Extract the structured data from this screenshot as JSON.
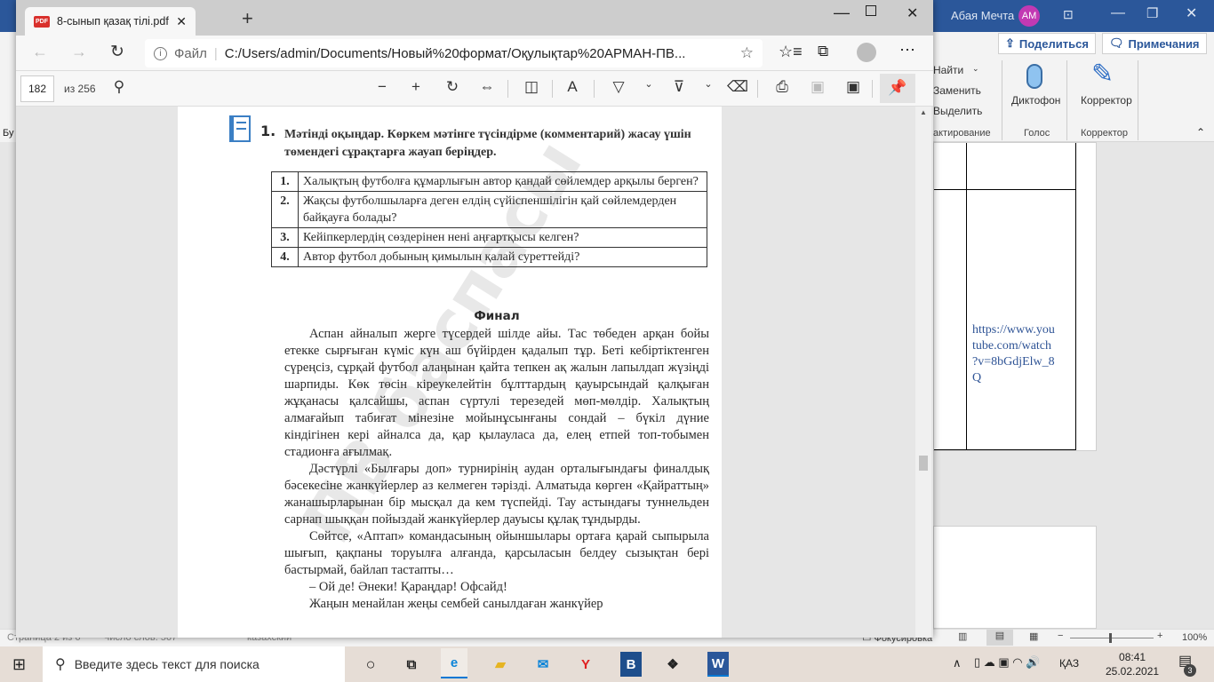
{
  "word": {
    "user_name": "Абая Мечта",
    "user_initials": "AM",
    "share_label": "Поделиться",
    "comments_label": "Примечания",
    "find_label": "Найти",
    "replace_label": "Заменить",
    "select_label": "Выделить",
    "editing_group": "актирование",
    "dictate_label": "Диктофон",
    "voice_group": "Голос",
    "editor_label": "Корректор",
    "editor_group": "Корректор",
    "left_cut_label": "Бу",
    "link_text": "https://www.youtube.com/watch?v=8bGdjElw_8Q",
    "link_lines": [
      "https://www.you",
      "tube.com/watch",
      "?v=8bGdjElw_8",
      "Q"
    ],
    "status": {
      "page": "Страница 2 из 6",
      "words": "Число слов: 567",
      "language": "казахский",
      "focus": "Фокусировка",
      "zoom": "100%"
    },
    "accent": "#2b579a"
  },
  "edge": {
    "tab_title": "8-сынып қазақ тілі.pdf",
    "url_prefix": "Файл",
    "url": "C:/Users/admin/Documents/Новый%20формат/Оқулықтар%20АРМАН-ПВ...",
    "pdf": {
      "page": "182",
      "of_pages": "из 256"
    }
  },
  "pdf_content": {
    "task_number": "1.",
    "task_text": "Мәтінді оқыңдар. Көркем мәтінге түсіндірме (комментарий) жасау үшін төмендегі сұрақтарға жауап беріңдер.",
    "questions": [
      {
        "n": "1.",
        "text": "Халықтың футболға құмарлығын автор қандай сөйлемдер арқылы берген?"
      },
      {
        "n": "2.",
        "text": "Жақсы футболшыларға деген елдің сүйіспеншілігін қай сөйлемдерден байқауға болады?"
      },
      {
        "n": "3.",
        "text": "Кейіпкерлердің сөздерінен нені аңғартқысы келген?"
      },
      {
        "n": "4.",
        "text": "Автор футбол добының қимылын қалай суреттейді?"
      }
    ],
    "story_title": "Финал",
    "paragraphs": [
      "Аспан айналып жерге түсердей шілде айы. Тас төбеден арқан бойы етекке сырғыған күміс күн аш бүйірден қадалып тұр. Беті кебіртіктенген сүреңсіз, сұрқай футбол алаңынан қайта тепкен ақ жалын лапылдап жүзіңді шарпиды. Көк төсін кіреукелейтін бұлттардың қауырсындай қалқыған жұқанасы қалсайшы, аспан сүртулі терезедей мөп-мөлдір. Халықтың алмағайып табиғат мінезіне мойынұсынғаны сондай – бүкіл дүние кіндігінен кері айналса да, қар қылауласа да, елең етпей топ-тобымен стадионға ағылмақ.",
      "Дәстүрлі «Былғары доп» турнирінің аудан орталығындағы финалдық бәсекесіне жанкүйерлер аз келмеген тәрізді. Алматыда көрген «Қайраттың» жанашырларынан бір мысқал да кем түспейді. Тау астындағы туннельден сарнап шыққан пойыздай жанкүйерлер дауысы құлақ тұндырды.",
      "Сөйтсе, «Аптап» командасының ойыншылары ортаға қарай сыпырыла шығып, қақпаны торуылға алғанда, қарсыласын белдеу сызықтан бері бастырмай, байлап тастапты…",
      "– Ой де! Әнеки! Қараңдар! Офсайд!",
      "Жаңын менайлан жеңы сембей санылдаған жанкүйер"
    ],
    "watermark": "АРМАН-ПВ баспасы"
  },
  "taskbar": {
    "search_placeholder": "Введите здесь текст для поиска",
    "language": "ҚАЗ",
    "time": "08:41",
    "date": "25.02.2021",
    "notifications": "3"
  }
}
